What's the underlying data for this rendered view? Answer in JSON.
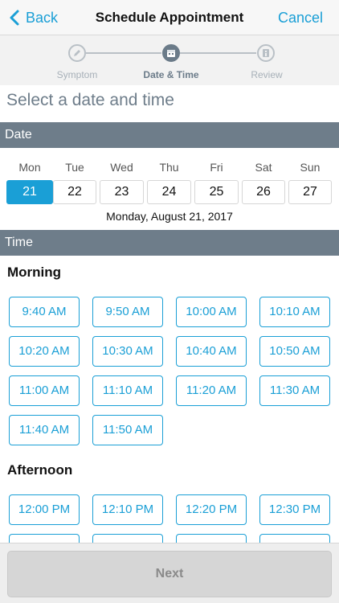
{
  "navbar": {
    "back_label": "Back",
    "title": "Schedule Appointment",
    "cancel_label": "Cancel"
  },
  "stepper": {
    "steps": [
      {
        "label": "Symptom",
        "icon": "pencil-icon",
        "state": "inactive"
      },
      {
        "label": "Date & Time",
        "icon": "calendar-icon",
        "state": "active"
      },
      {
        "label": "Review",
        "icon": "info-icon",
        "state": "inactive"
      }
    ]
  },
  "heading": "Select a date and time",
  "date_section": {
    "title": "Date",
    "days": [
      {
        "name": "Mon",
        "num": "21",
        "selected": true
      },
      {
        "name": "Tue",
        "num": "22",
        "selected": false
      },
      {
        "name": "Wed",
        "num": "23",
        "selected": false
      },
      {
        "name": "Thu",
        "num": "24",
        "selected": false
      },
      {
        "name": "Fri",
        "num": "25",
        "selected": false
      },
      {
        "name": "Sat",
        "num": "26",
        "selected": false
      },
      {
        "name": "Sun",
        "num": "27",
        "selected": false
      }
    ],
    "selected_full": "Monday, August 21, 2017"
  },
  "time_section": {
    "title": "Time",
    "morning": {
      "title": "Morning",
      "slots": [
        "9:40 AM",
        "9:50 AM",
        "10:00 AM",
        "10:10 AM",
        "10:20 AM",
        "10:30 AM",
        "10:40 AM",
        "10:50 AM",
        "11:00 AM",
        "11:10 AM",
        "11:20 AM",
        "11:30 AM",
        "11:40 AM",
        "11:50 AM"
      ]
    },
    "afternoon": {
      "title": "Afternoon",
      "slots": [
        "12:00 PM",
        "12:10 PM",
        "12:20 PM",
        "12:30 PM",
        "",
        "",
        "",
        ""
      ]
    }
  },
  "footer": {
    "next_label": "Next"
  },
  "colors": {
    "accent": "#1a9fd6",
    "band": "#6e7d8a",
    "disabled": "#d6d6d6"
  }
}
